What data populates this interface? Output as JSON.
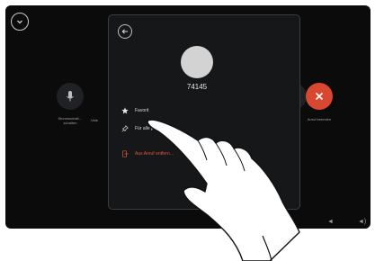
{
  "call_screen": {
    "mute_label": "Stummschalt… schalten",
    "video_label": "Vide",
    "end_label": "Anruf beenden"
  },
  "contact_card": {
    "name": "74145",
    "menu": [
      {
        "label": "Favorit",
        "icon": "star-icon"
      },
      {
        "label": "Für alle pr…",
        "icon": "pin-icon"
      },
      {
        "label": "Aus Anruf entfern…",
        "icon": "remove-from-call-icon"
      }
    ]
  },
  "colors": {
    "screen_background": "#0b0b0c",
    "modal_background": "#161719",
    "end_call": "#d8472f",
    "danger_text": "#e0533f"
  }
}
